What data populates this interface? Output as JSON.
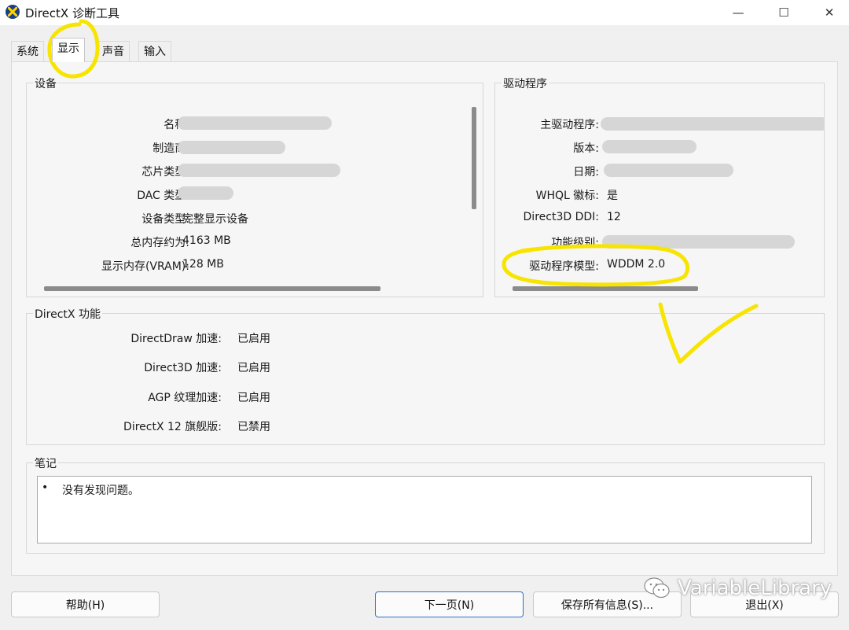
{
  "window": {
    "title": "DirectX 诊断工具",
    "minimize_glyph": "—",
    "maximize_glyph": "☐",
    "close_glyph": "✕"
  },
  "tabs": [
    {
      "label": "系统",
      "active": false
    },
    {
      "label": "显示",
      "active": true
    },
    {
      "label": "声音",
      "active": false
    },
    {
      "label": "输入",
      "active": false
    }
  ],
  "device": {
    "title": "设备",
    "rows": [
      {
        "label": "名称:",
        "value": ""
      },
      {
        "label": "制造商:",
        "value": ""
      },
      {
        "label": "芯片类型:",
        "value": ""
      },
      {
        "label": "DAC 类型:",
        "value": ""
      },
      {
        "label": "设备类型:",
        "value": "完整显示设备"
      },
      {
        "label": "总内存约为:",
        "value": "4163 MB"
      },
      {
        "label": "显示内存(VRAM):",
        "value": "128 MB"
      }
    ]
  },
  "driver": {
    "title": "驱动程序",
    "rows": [
      {
        "label": "主驱动程序:",
        "value": ""
      },
      {
        "label": "版本:",
        "value": ""
      },
      {
        "label": "日期:",
        "value": ""
      },
      {
        "label": "WHQL 徽标:",
        "value": "是"
      },
      {
        "label": "Direct3D DDI:",
        "value": "12"
      },
      {
        "label": "功能级别:",
        "value": ""
      },
      {
        "label": "驱动程序模型:",
        "value": "WDDM 2.0"
      }
    ]
  },
  "features": {
    "title": "DirectX 功能",
    "rows": [
      {
        "label": "DirectDraw 加速:",
        "value": "已启用"
      },
      {
        "label": "Direct3D 加速:",
        "value": "已启用"
      },
      {
        "label": "AGP 纹理加速:",
        "value": "已启用"
      },
      {
        "label": "DirectX 12 旗舰版:",
        "value": "已禁用"
      }
    ]
  },
  "notes": {
    "title": "笔记",
    "bullet": "•",
    "text": "没有发现问题。"
  },
  "buttons": {
    "help": "帮助(H)",
    "next": "下一页(N)",
    "save": "保存所有信息(S)...",
    "exit": "退出(X)"
  },
  "watermark": "VariableLibrary",
  "colors": {
    "highlight": "#f7e400",
    "app_icon": "#1b3f86",
    "default_button_border": "#2f6fc6"
  }
}
